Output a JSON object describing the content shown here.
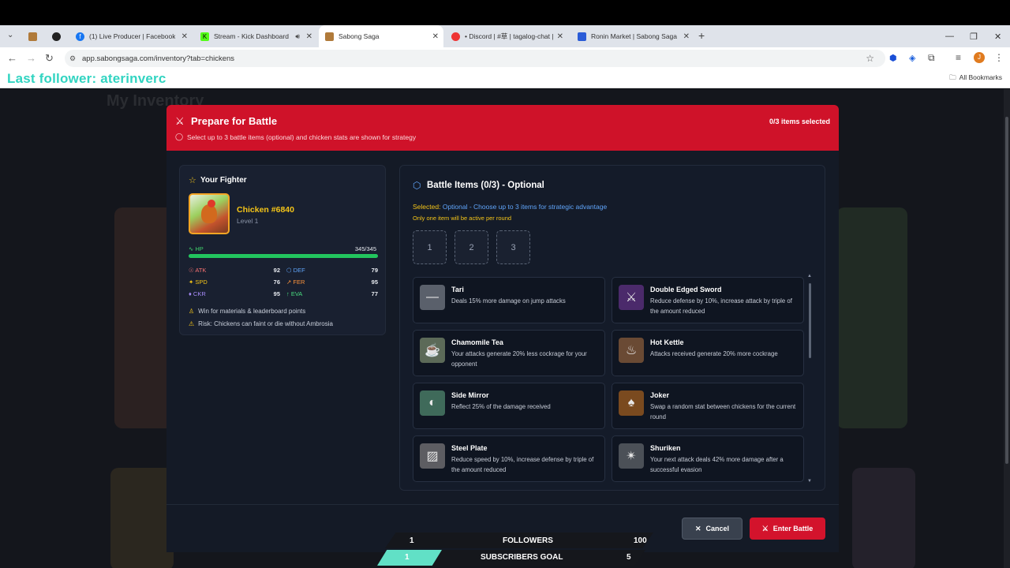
{
  "browser": {
    "tabs": [
      {
        "title": "",
        "icon": "sabong-icon"
      },
      {
        "title": "",
        "icon": "github-icon"
      },
      {
        "title": "(1) Live Producer | Facebook",
        "icon": "facebook-icon"
      },
      {
        "title": "Stream - Kick Dashboard",
        "icon": "kick-icon"
      },
      {
        "title": "Sabong Saga",
        "icon": "sabong-icon"
      },
      {
        "title": "• Discord | #草 | tagalog-chat |",
        "icon": "discord-icon"
      },
      {
        "title": "Ronin Market | Sabong Saga C",
        "icon": "ronin-icon"
      }
    ],
    "url": "app.sabongsaga.com/inventory?tab=chickens",
    "all_bookmarks": "All Bookmarks",
    "overlay_follower": "Last follower: aterinverc"
  },
  "page": {
    "ghost_title": "My Inventory"
  },
  "modal": {
    "title": "Prepare for Battle",
    "subtitle": "Select up to 3 battle items (optional) and chicken stats are shown for strategy",
    "count": "0/3 items selected",
    "cancel_label": "Cancel",
    "enter_label": "Enter Battle"
  },
  "fighter": {
    "title": "Your Fighter",
    "name": "Chicken #6840",
    "level": "Level 1",
    "hp_label": "HP",
    "hp_value": "345/345",
    "hp_fraction": 1.0,
    "stats": [
      {
        "name": "ATK",
        "value": "92",
        "color": "#f87171",
        "icon": "☉"
      },
      {
        "name": "DEF",
        "value": "79",
        "color": "#60a5fa",
        "icon": "⬡"
      },
      {
        "name": "SPD",
        "value": "76",
        "color": "#f5c518",
        "icon": "✦"
      },
      {
        "name": "FER",
        "value": "95",
        "color": "#fb923c",
        "icon": "↗"
      },
      {
        "name": "CKR",
        "value": "95",
        "color": "#a78bfa",
        "icon": "♦"
      },
      {
        "name": "EVA",
        "value": "77",
        "color": "#4ade80",
        "icon": "↑"
      }
    ],
    "notes": [
      {
        "text": "Win for materials & leaderboard points",
        "icon": "trophy-icon",
        "glyph": "♙",
        "color": "#f5c518"
      },
      {
        "text": "Risk: Chickens can faint or die without Ambrosia",
        "icon": "warning-icon",
        "glyph": "⚠",
        "color": "#f5c518"
      }
    ]
  },
  "battle_items": {
    "title": "Battle Items (0/3) - Optional",
    "selected_prefix": "Selected:",
    "selected_text": "Optional - Choose up to 3 items for strategic advantage",
    "note": "Only one item will be active per round",
    "slots": [
      "1",
      "2",
      "3"
    ],
    "items": [
      {
        "name": "Tari",
        "desc": "Deals 15% more damage on jump attacks",
        "icon": "tari-icon",
        "glyph": "―",
        "bg": "#5a606b"
      },
      {
        "name": "Double Edged Sword",
        "desc": "Reduce defense by 10%, increase attack by triple of the amount reduced",
        "icon": "double-edged-sword-icon",
        "glyph": "⚔",
        "bg": "#4b2a6b"
      },
      {
        "name": "Chamomile Tea",
        "desc": "Your attacks generate 20% less cockrage for your opponent",
        "icon": "chamomile-tea-icon",
        "glyph": "☕",
        "bg": "#5c6a58"
      },
      {
        "name": "Hot Kettle",
        "desc": "Attacks received generate 20% more cockrage",
        "icon": "hot-kettle-icon",
        "glyph": "♨",
        "bg": "#6a4a34"
      },
      {
        "name": "Side Mirror",
        "desc": "Reflect 25% of the damage received",
        "icon": "side-mirror-icon",
        "glyph": "◐",
        "bg": "#3f6a5a"
      },
      {
        "name": "Joker",
        "desc": "Swap a random stat between chickens for the current round",
        "icon": "joker-card-icon",
        "glyph": "♠",
        "bg": "#7a4a1f"
      },
      {
        "name": "Steel Plate",
        "desc": "Reduce speed by 10%, increase defense by triple of the amount reduced",
        "icon": "steel-plate-icon",
        "glyph": "▨",
        "bg": "#5d5d62"
      },
      {
        "name": "Shuriken",
        "desc": "Your next attack deals 42% more damage after a successful evasion",
        "icon": "shuriken-icon",
        "glyph": "✴",
        "bg": "#4b5057"
      }
    ]
  },
  "stream_overlay": {
    "followers_count": "1",
    "followers_label": "FOLLOWERS",
    "followers_goal": "100",
    "subs_count": "1",
    "subs_label": "SUBSCRIBERS GOAL",
    "subs_goal": "5"
  }
}
